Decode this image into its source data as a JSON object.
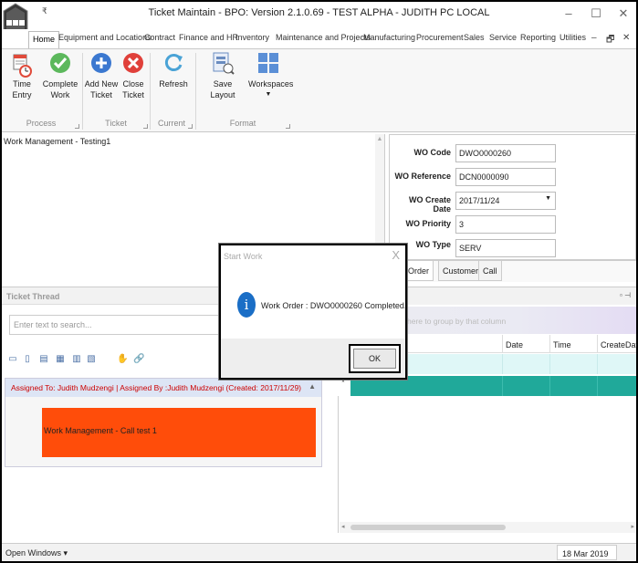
{
  "window": {
    "title": "Ticket Maintain - BPO: Version 2.1.0.69 - TEST ALPHA - JUDITH PC LOCAL",
    "qat_glyph": "₹",
    "controls": {
      "minimize": "–",
      "maximize": "☐",
      "close": "✕"
    }
  },
  "ribbon": {
    "tabs": [
      "Home",
      "Equipment and Locations",
      "Contract",
      "Finance and HR",
      "Inventory",
      "Maintenance and Projects",
      "Manufacturing",
      "Procurement",
      "Sales",
      "Service",
      "Reporting",
      "Utilities"
    ],
    "right_controls": {
      "minimize": "–",
      "restore": "🗗",
      "close": "✕"
    },
    "buttons": {
      "time_entry": "Time Entry",
      "complete_work": "Complete Work",
      "add_new_ticket": "Add New Ticket",
      "close_ticket": "Close Ticket",
      "refresh": "Refresh",
      "save_layout": "Save Layout",
      "workspaces": "Workspaces"
    },
    "groups": {
      "process": "Process",
      "ticket": "Ticket",
      "current": "Current",
      "format": "Format"
    },
    "icon_names": [
      "time-entry-icon",
      "checkmark-icon",
      "add-icon",
      "close-icon",
      "refresh-icon",
      "save-layout-icon",
      "workspaces-icon"
    ],
    "colors": {
      "check": "#4caf50",
      "add": "#3b78d0",
      "close": "#e0403a",
      "refresh": "#4aa3d6"
    }
  },
  "upper_left": {
    "text": "Work Management  - Testing1"
  },
  "form": {
    "wo_code_label": "WO Code",
    "wo_code": "DWO0000260",
    "wo_reference_label": "WO Reference",
    "wo_reference": "DCN0000090",
    "wo_create_date_label": "WO Create Date",
    "wo_create_date": "2017/11/24",
    "wo_priority_label": "WO Priority",
    "wo_priority": "3",
    "wo_type_label": "WO Type",
    "wo_type": "SERV",
    "tabs": [
      "rk Order",
      "Customer",
      "Call"
    ]
  },
  "thread": {
    "title": "Ticket Thread",
    "search_placeholder": "Enter text to search...",
    "assignment": "Assigned To: Judith Mudzengi | Assigned By :Judith Mudzengi (Created: 2017/11/29)",
    "note": "Work Management  - Call test 1",
    "note_color": "#ff4d0a"
  },
  "grid": {
    "group_hint": "here to group by that column",
    "columns": [
      "Date",
      "Time",
      "CreateDate"
    ],
    "new_row_marker": "*",
    "row_color": "#20a99a"
  },
  "statusbar": {
    "open_windows": "Open Windows ▾",
    "date": "18 Mar 2019"
  },
  "modal": {
    "title": "Start Work",
    "close": "X",
    "icon": "i",
    "message": "Work Order : DWO0000260 Completed.",
    "ok": "OK"
  }
}
